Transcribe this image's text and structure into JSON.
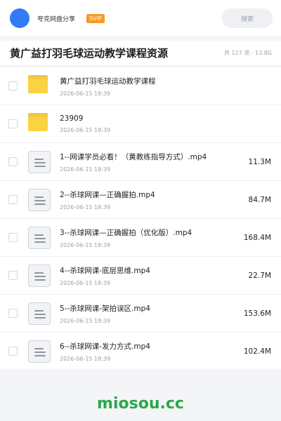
{
  "header": {
    "user_name": "夸克网盘分享",
    "badge": "SVIP",
    "search_label": "搜索"
  },
  "folder": {
    "title": "黄广益打羽毛球运动教学课程资源",
    "summary": "共 127 项 · 13.8G"
  },
  "files": [
    {
      "type": "folder",
      "name": "黄广益打羽毛球运动教学课程",
      "date": "2026-06-15 18:39",
      "size": ""
    },
    {
      "type": "folder",
      "name": "23909",
      "date": "2026-06-15 18:39",
      "size": ""
    },
    {
      "type": "file",
      "name": "1--网课学员必看！（黄教练指导方式）.mp4",
      "date": "2026-06-15 18:39",
      "size": "11.3M"
    },
    {
      "type": "file",
      "name": "2--杀球网课—正确握拍.mp4",
      "date": "2026-06-15 18:39",
      "size": "84.7M"
    },
    {
      "type": "file",
      "name": "3--杀球网课—正确握拍（优化版）.mp4",
      "date": "2026-06-15 18:39",
      "size": "168.4M"
    },
    {
      "type": "file",
      "name": "4--杀球网课-底层思维.mp4",
      "date": "2026-06-15 18:39",
      "size": "22.7M"
    },
    {
      "type": "file",
      "name": "5--杀球网课-架拍误区.mp4",
      "date": "2026-06-15 18:39",
      "size": "153.6M"
    },
    {
      "type": "file",
      "name": "6--杀球网课-发力方式.mp4",
      "date": "2026-06-15 18:39",
      "size": "102.4M"
    }
  ],
  "watermark": "miosou.cc",
  "colors": {
    "accent": "#2f7cf6",
    "badge": "#f59a23",
    "folder": "#fbd23f",
    "watermark": "#2aa84a"
  }
}
